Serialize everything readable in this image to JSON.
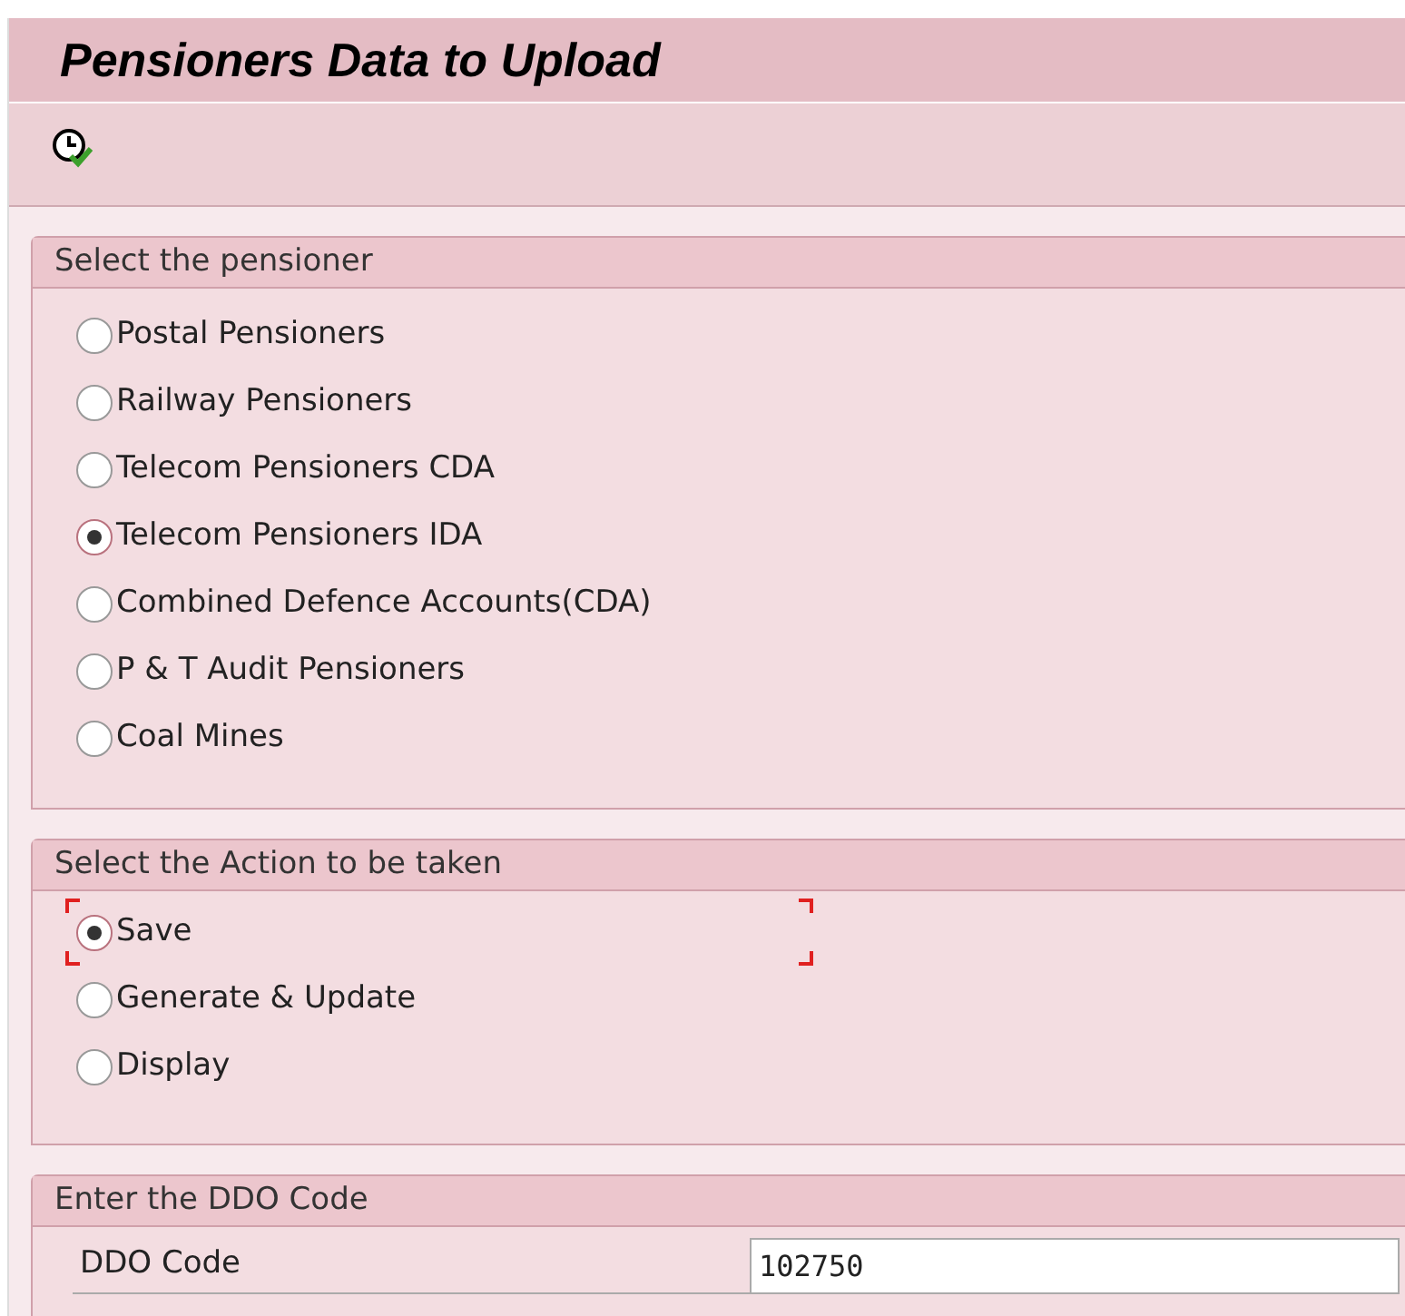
{
  "title": "Pensioners Data to Upload",
  "toolbar": {
    "buttons": [
      {
        "kind": "execute"
      }
    ]
  },
  "pensioner_group": {
    "title": "Select the pensioner",
    "options": [
      {
        "label": "Postal Pensioners",
        "selected": false
      },
      {
        "label": "Railway Pensioners",
        "selected": false
      },
      {
        "label": "Telecom Pensioners CDA",
        "selected": false
      },
      {
        "label": "Telecom Pensioners IDA",
        "selected": true
      },
      {
        "label": "Combined Defence Accounts(CDA)",
        "selected": false
      },
      {
        "label": "P & T Audit Pensioners",
        "selected": false
      },
      {
        "label": "Coal Mines",
        "selected": false
      }
    ]
  },
  "action_group": {
    "title": "Select the Action to be taken",
    "options": [
      {
        "label": "Save",
        "selected": true,
        "focused": true
      },
      {
        "label": "Generate & Update",
        "selected": false,
        "focused": false
      },
      {
        "label": "Display",
        "selected": false,
        "focused": false
      }
    ]
  },
  "ddo_group": {
    "title": "Enter the DDO Code",
    "field": {
      "label": "DDO Code",
      "value": "102750"
    }
  }
}
